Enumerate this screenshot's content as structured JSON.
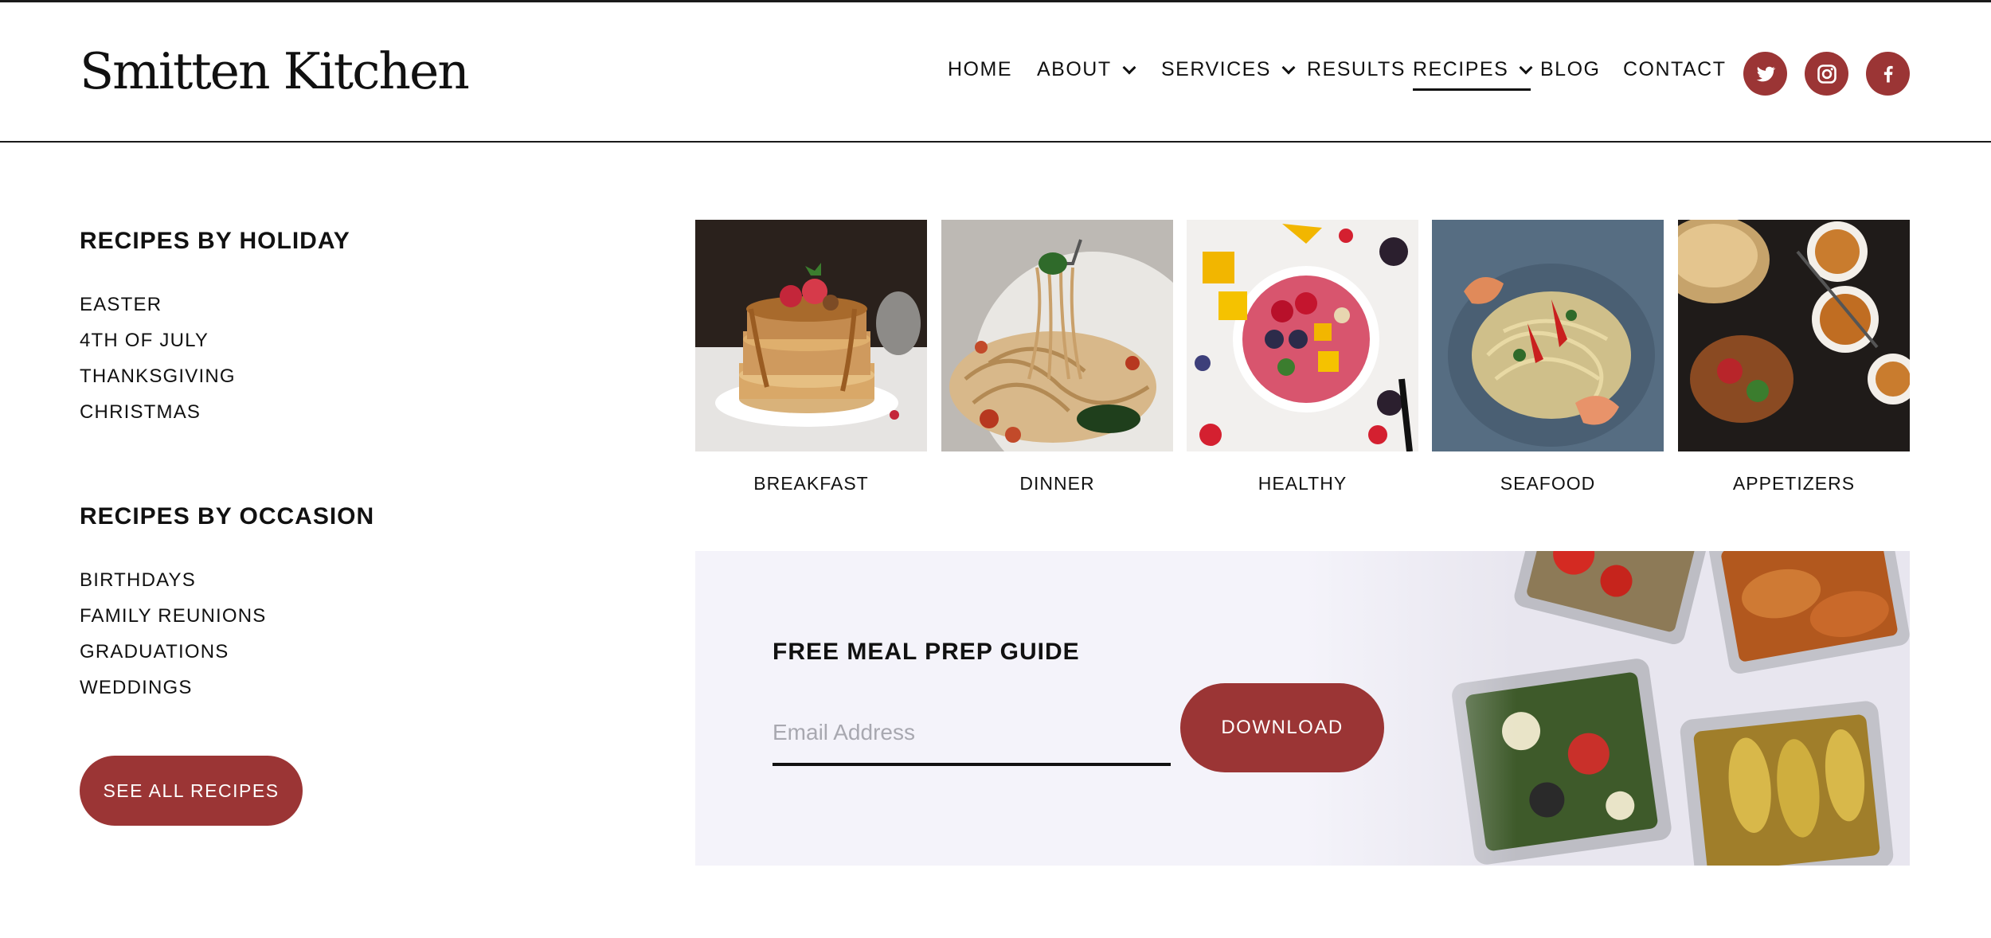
{
  "site": {
    "logo": "Smitten Kitchen"
  },
  "nav": {
    "items": [
      {
        "label": "HOME"
      },
      {
        "label": "ABOUT"
      },
      {
        "label": "SERVICES"
      },
      {
        "label": "RESULTS"
      },
      {
        "label": "RECIPES"
      },
      {
        "label": "BLOG"
      },
      {
        "label": "CONTACT"
      }
    ],
    "active": "RECIPES",
    "social": [
      "twitter-icon",
      "instagram-icon",
      "facebook-icon"
    ]
  },
  "holiday": {
    "heading": "RECIPES BY HOLIDAY",
    "links": [
      "EASTER",
      "4TH OF JULY",
      "THANKSGIVING",
      "CHRISTMAS"
    ]
  },
  "occasion": {
    "heading": "RECIPES BY OCCASION",
    "links": [
      "BIRTHDAYS",
      "FAMILY REUNIONS",
      "GRADUATIONS",
      "WEDDINGS"
    ]
  },
  "see_all_label": "SEE ALL RECIPES",
  "categories": [
    {
      "label": "BREAKFAST"
    },
    {
      "label": "DINNER"
    },
    {
      "label": "HEALTHY"
    },
    {
      "label": "SEAFOOD"
    },
    {
      "label": "APPETIZERS"
    }
  ],
  "promo": {
    "title": "FREE MEAL PREP GUIDE",
    "email_placeholder": "Email Address",
    "email_value": "",
    "button_label": "DOWNLOAD"
  },
  "colors": {
    "accent": "#9b3535",
    "text": "#111111",
    "promo_bg": "#f4f3fa"
  }
}
